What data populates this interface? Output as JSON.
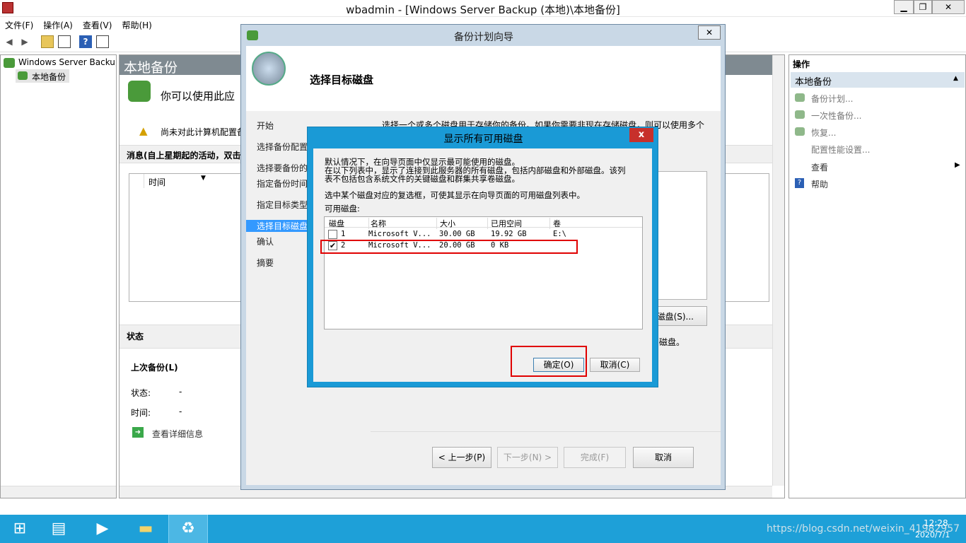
{
  "window": {
    "title": "wbadmin - [Windows Server Backup (本地)\\本地备份]",
    "minimize": "▁",
    "restore": "❐",
    "close": "✕"
  },
  "menu": [
    "文件(F)",
    "操作(A)",
    "查看(V)",
    "帮助(H)"
  ],
  "tree": {
    "root": "Windows Server Backup",
    "child": "本地备份"
  },
  "main": {
    "header": "本地备份",
    "intro": "你可以使用此应",
    "warning": "尚未对此计算机配置备",
    "messages_title": "消息(自上星期起的活动，双击",
    "col_time": "时间",
    "status_title": "状态",
    "last_backup": "上次备份(L)",
    "status_label": "状态:",
    "status_value": "-",
    "time_label": "时间:",
    "time_value": "-",
    "details_link": "查看详细信息"
  },
  "actions": {
    "title": "操作",
    "section": "本地备份",
    "items": [
      "备份计划...",
      "一次性备份...",
      "恢复...",
      "配置性能设置..."
    ],
    "view": "查看",
    "help": "帮助"
  },
  "wizard": {
    "title": "备份计划向导",
    "close": "✕",
    "heading": "选择目标磁盘",
    "nav": [
      "开始",
      "选择备份配置",
      "选择要备份的",
      "指定备份时间",
      "指定目标类型",
      "选择目标磁盘",
      "确认",
      "摘要"
    ],
    "desc1": "选择一个或多个磁盘用于存储你的备份。如果你需要非现在存储磁盘，则可以使用多个",
    "desc_right": "磁盘(S)...",
    "desc2": "磁盘。",
    "prev": "< 上一步(P)",
    "next": "下一步(N) >",
    "finish": "完成(F)",
    "cancel": "取消"
  },
  "dialog": {
    "title": "显示所有可用磁盘",
    "close": "x",
    "line1": "默认情况下，在向导页面中仅显示最可能使用的磁盘。",
    "line2": "在以下列表中，显示了连接到此服务器的所有磁盘，包括内部磁盘和外部磁盘。该列",
    "line3": "表不包括包含系统文件的关键磁盘和群集共享卷磁盘。",
    "line4": "选中某个磁盘对应的复选框，可使其显示在向导页面的可用磁盘列表中。",
    "list_label": "可用磁盘:",
    "columns": [
      "磁盘",
      "名称",
      "大小",
      "已用空间",
      "卷"
    ],
    "rows": [
      {
        "disk": "1",
        "name": "Microsoft V...",
        "size": "30.00 GB",
        "used": "19.92 GB",
        "vol": "E:\\",
        "checked": false
      },
      {
        "disk": "2",
        "name": "Microsoft V...",
        "size": "20.00 GB",
        "used": "0 KB",
        "vol": "",
        "checked": true
      }
    ],
    "ok": "确定(O)",
    "cancel": "取消(C)"
  },
  "taskbar": {
    "time": "12:28",
    "date": "2020/7/1",
    "watermark": "https://blog.csdn.net/weixin_41982957"
  },
  "colors": {
    "taskbar": "#1ea0d8",
    "dialog_border": "#1a9ad6",
    "highlight": "#e00000",
    "selected_nav": "#3399ff"
  }
}
